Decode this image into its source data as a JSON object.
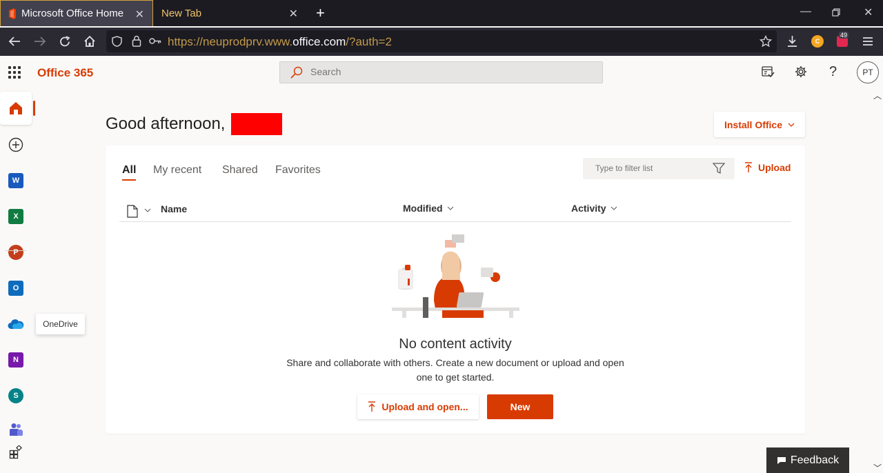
{
  "browser": {
    "tabs": [
      {
        "title": "Microsoft Office Home",
        "active": true
      },
      {
        "title": "New Tab",
        "active": false
      }
    ],
    "url_prefix": "https://neuprodprv.www.",
    "url_domain": "office.com",
    "url_suffix": "/?auth=2",
    "extension_badge": "49"
  },
  "header": {
    "brand": "Office 365",
    "search_placeholder": "Search",
    "avatar_initials": "PT"
  },
  "rail": {
    "items": [
      {
        "name": "home"
      },
      {
        "name": "create"
      },
      {
        "name": "word",
        "letter": "W",
        "color": "#185abd"
      },
      {
        "name": "excel",
        "letter": "X",
        "color": "#107c41"
      },
      {
        "name": "powerpoint",
        "letter": "P",
        "color": "#c43e1c"
      },
      {
        "name": "outlook",
        "letter": "O",
        "color": "#0f6cbd"
      },
      {
        "name": "onedrive"
      },
      {
        "name": "onenote",
        "letter": "N",
        "color": "#7719aa"
      },
      {
        "name": "sharepoint",
        "letter": "S",
        "color": "#038387"
      },
      {
        "name": "teams"
      },
      {
        "name": "all-apps"
      }
    ],
    "tooltip": "OneDrive"
  },
  "main": {
    "greeting": "Good afternoon,",
    "install_label": "Install Office",
    "tabs": [
      "All",
      "My recent",
      "Shared",
      "Favorites"
    ],
    "filter_placeholder": "Type to filter list",
    "upload_label": "Upload",
    "columns": {
      "name": "Name",
      "modified": "Modified",
      "activity": "Activity"
    },
    "empty_title": "No content activity",
    "empty_desc": "Share and collaborate with others. Create a new document or upload and open one to get started.",
    "upload_open_label": "Upload and open...",
    "new_label": "New"
  },
  "feedback_label": "Feedback",
  "colors": {
    "accent": "#d83b01"
  }
}
